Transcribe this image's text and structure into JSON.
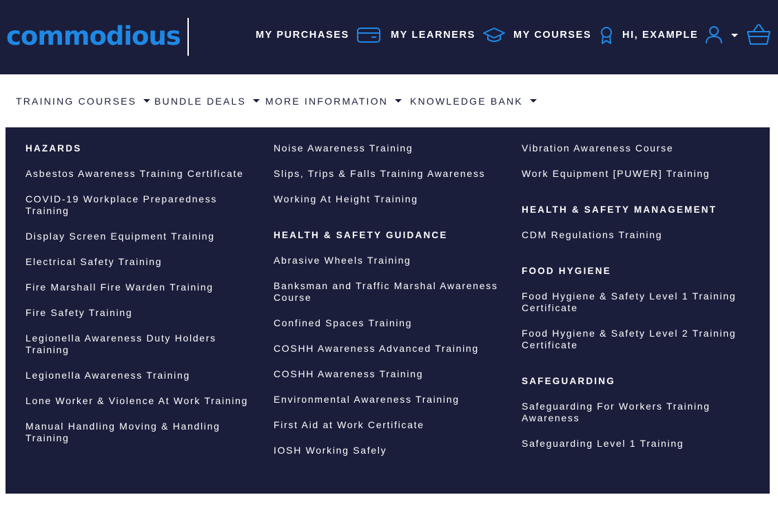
{
  "brand": {
    "logo_text": "commodious"
  },
  "header": {
    "purchases_label": "MY PURCHASES",
    "learners_label": "MY LEARNERS",
    "courses_label": "MY COURSES",
    "greeting_label": "HI, EXAMPLE",
    "icons": [
      "credit-card-icon",
      "graduation-cap-icon",
      "award-ribbon-icon",
      "user-icon",
      "basket-icon"
    ],
    "accent_color": "#1f88e5",
    "background_color": "#1b1e3b"
  },
  "secondary_nav": {
    "items": [
      {
        "label": "TRAINING COURSES"
      },
      {
        "label": "BUNDLE DEALS"
      },
      {
        "label": "MORE INFORMATION"
      },
      {
        "label": "KNOWLEDGE BANK"
      }
    ],
    "active_index": 0
  },
  "mega_menu": {
    "col1": {
      "heading": "HAZARDS",
      "links": [
        "Asbestos Awareness Training Certificate",
        "COVID-19 Workplace Preparedness Training",
        "Display Screen Equipment Training",
        "Electrical Safety Training",
        "Fire Marshall Fire Warden Training",
        "Fire Safety Training",
        "Legionella Awareness Duty Holders Training",
        "Legionella Awareness Training",
        "Lone Worker & Violence At Work Training",
        "Manual Handling Moving & Handling Training"
      ]
    },
    "col2": {
      "top_links": [
        "Noise Awareness Training",
        "Slips, Trips & Falls Training Awareness",
        "Working At Height Training"
      ],
      "heading": "HEALTH & SAFETY GUIDANCE",
      "links": [
        "Abrasive Wheels Training",
        "Banksman and Traffic Marshal Awareness Course",
        "Confined Spaces Training",
        "COSHH Awareness Advanced Training",
        "COSHH Awareness Training",
        "Environmental Awareness Training",
        "First Aid at Work Certificate",
        "IOSH Working Safely"
      ]
    },
    "col3": {
      "top_links": [
        "Vibration Awareness Course",
        "Work Equipment [PUWER] Training"
      ],
      "hs_management": {
        "heading": "HEALTH & SAFETY MANAGEMENT",
        "links": [
          "CDM Regulations Training"
        ]
      },
      "food_hygiene": {
        "heading": "FOOD HYGIENE",
        "links": [
          "Food Hygiene & Safety Level 1 Training Certificate",
          "Food Hygiene & Safety Level 2 Training Certificate"
        ]
      },
      "safeguarding": {
        "heading": "SAFEGUARDING",
        "links": [
          "Safeguarding For Workers Training Awareness",
          "Safeguarding Level 1 Training"
        ]
      }
    }
  }
}
